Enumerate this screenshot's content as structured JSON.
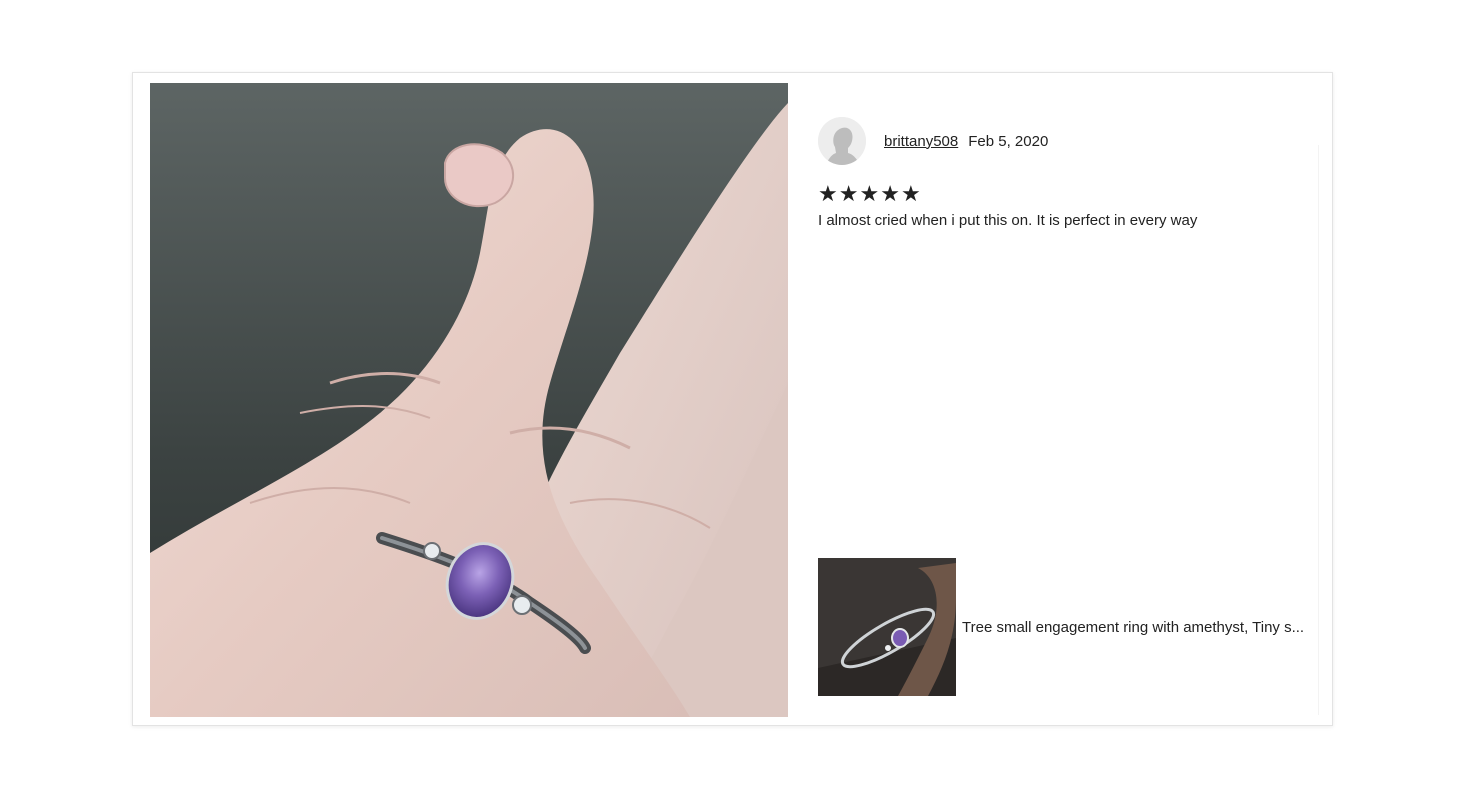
{
  "review": {
    "reviewer_name": "brittany508",
    "date": "Feb 5, 2020",
    "rating": 5,
    "stars": [
      "★",
      "★",
      "★",
      "★",
      "★"
    ],
    "text": "I almost cried when i put this on. It is perfect in every way"
  },
  "listing": {
    "title": "Tree small engagement ring with amethyst, Tiny s..."
  },
  "icons": {
    "avatar": "default-user-avatar-icon",
    "star": "star-icon"
  },
  "colors": {
    "text": "#222222",
    "border": "#e3e3e3",
    "avatar_bg": "#ededed",
    "gem": "#7b5fb0"
  }
}
